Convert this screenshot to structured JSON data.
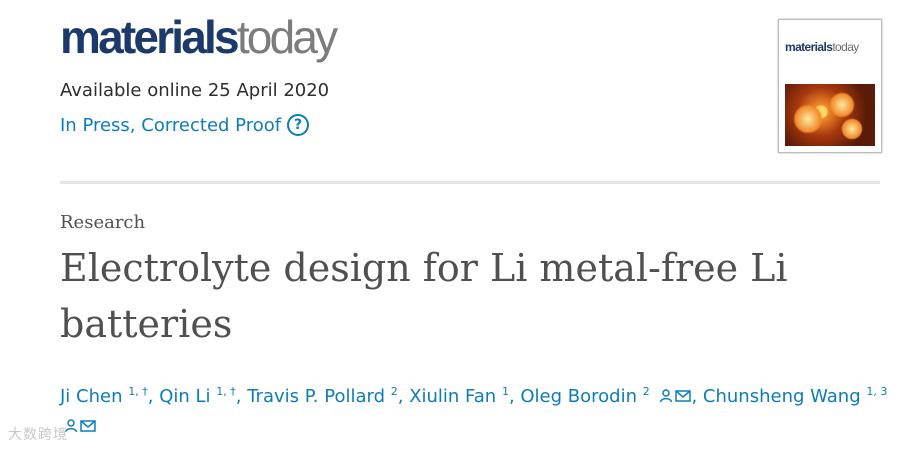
{
  "journal": {
    "logo_part1": "materials",
    "logo_part2": "today"
  },
  "availability": "Available online 25 April 2020",
  "status": {
    "label": "In Press, Corrected Proof",
    "help_icon": "?"
  },
  "cover": {
    "brand_part1": "materials",
    "brand_part2": "today"
  },
  "article": {
    "category": "Research",
    "title": "Electrolyte design for Li metal-free Li batteries"
  },
  "authors": [
    {
      "name": "Ji Chen",
      "sup": "1, †"
    },
    {
      "name": "Qin Li",
      "sup": "1, †"
    },
    {
      "name": "Travis P. Pollard",
      "sup": "2"
    },
    {
      "name": "Xiulin Fan",
      "sup": "1"
    },
    {
      "name": "Oleg Borodin",
      "sup": "2"
    },
    {
      "name": "Chunsheng Wang",
      "sup": "1, 3"
    }
  ],
  "watermark": "大数跨境",
  "colors": {
    "link": "#0c7dbb",
    "brand_blue": "#1b3a6b",
    "brand_grey": "#7c7c7c",
    "title": "#505050"
  }
}
